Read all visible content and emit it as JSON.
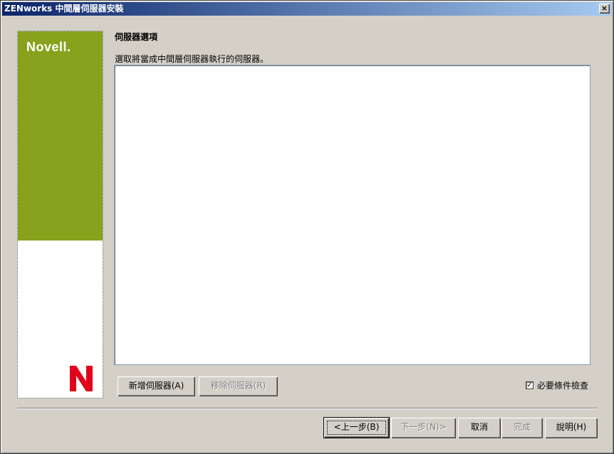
{
  "window": {
    "title": "ZENworks 中間層伺服器安裝",
    "close_glyph": "×"
  },
  "banner": {
    "logo_text": "Novell.",
    "mark_color": "#e2001a",
    "green_color": "#87a21d"
  },
  "main": {
    "section_title": "伺服器選項",
    "instruction": "選取將當成中間層伺服器執行的伺服器。",
    "server_list": []
  },
  "actions": {
    "add_server": "新增伺服器(A)",
    "remove_server": "移除伺服器(R)",
    "prereq_check_label": "必要條件檢查",
    "prereq_check_checked": true,
    "check_glyph": "✓"
  },
  "footer": {
    "back": "<上一步(B)",
    "next": "下一步(N)>",
    "cancel": "取消",
    "finish": "完成",
    "help": "說明(H)"
  }
}
